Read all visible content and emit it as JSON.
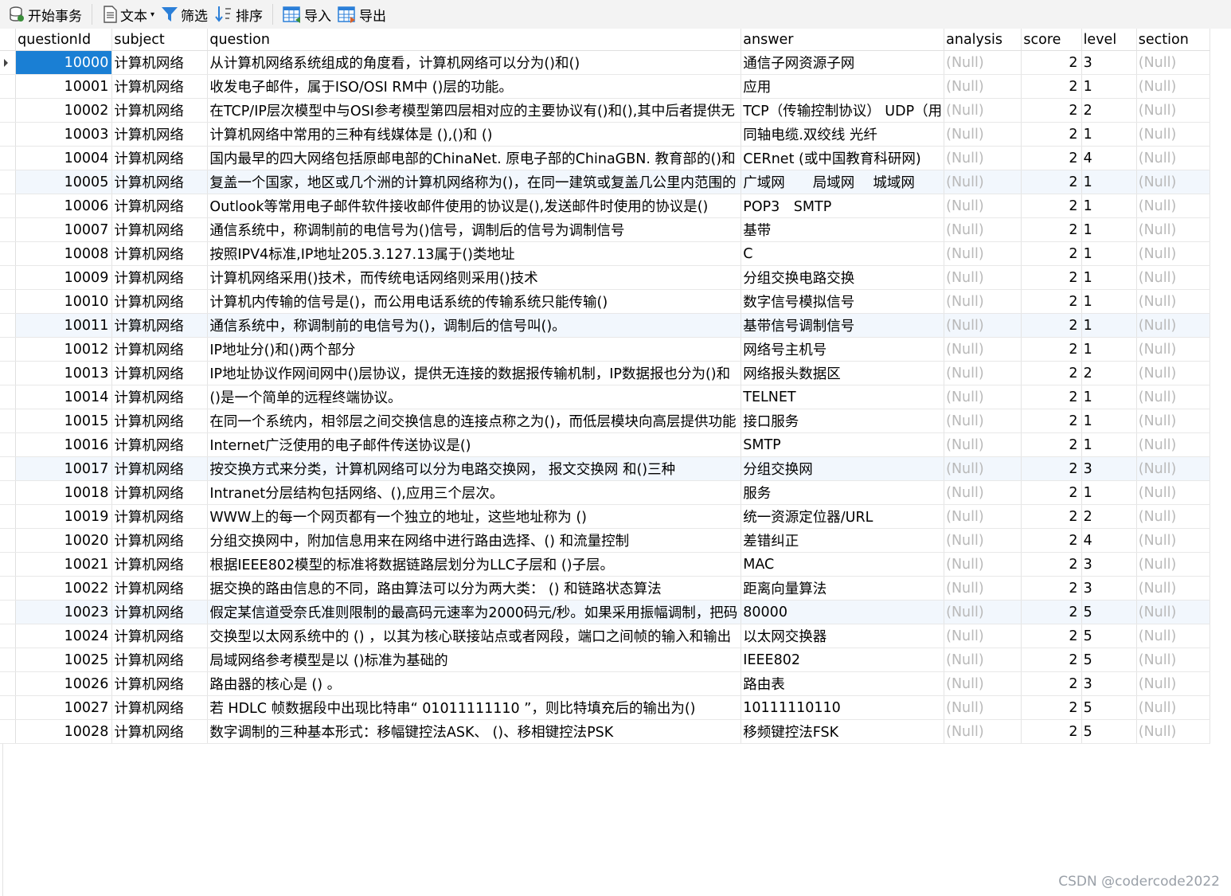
{
  "toolbar": {
    "begin_transaction": "开始事务",
    "text": "文本",
    "filter": "筛选",
    "sort": "排序",
    "import": "导入",
    "export": "导出"
  },
  "columns": [
    "questionId",
    "subject",
    "question",
    "answer",
    "analysis",
    "score",
    "level",
    "section"
  ],
  "rows": [
    [
      "10000",
      "计算机网络",
      "从计算机网络系统组成的角度看，计算机网络可以分为()和()",
      "通信子网资源子网",
      "(Null)",
      "2",
      "3",
      "(Null)"
    ],
    [
      "10001",
      "计算机网络",
      "收发电子邮件，属于ISO/OSI RM中 ()层的功能。",
      "应用",
      "(Null)",
      "2",
      "1",
      "(Null)"
    ],
    [
      "10002",
      "计算机网络",
      "在TCP/IP层次模型中与OSI参考模型第四层相对应的主要协议有()和(),其中后者提供无",
      "TCP（传输控制协议） UDP（用",
      "(Null)",
      "2",
      "2",
      "(Null)"
    ],
    [
      "10003",
      "计算机网络",
      "计算机网络中常用的三种有线媒体是 (),()和 ()",
      "同轴电缆.双绞线 光纤",
      "(Null)",
      "2",
      "1",
      "(Null)"
    ],
    [
      "10004",
      "计算机网络",
      "国内最早的四大网络包括原邮电部的ChinaNet. 原电子部的ChinaGBN. 教育部的()和",
      "CERnet (或中国教育科研网)",
      "(Null)",
      "2",
      "4",
      "(Null)"
    ],
    [
      "10005",
      "计算机网络",
      "复盖一个国家，地区或几个洲的计算机网络称为()，在同一建筑或复盖几公里内范围的",
      "广域网　　局域网　 城域网",
      "(Null)",
      "2",
      "1",
      "(Null)"
    ],
    [
      "10006",
      "计算机网络",
      "Outlook等常用电子邮件软件接收邮件使用的协议是(),发送邮件时使用的协议是()",
      "POP3　SMTP",
      "(Null)",
      "2",
      "1",
      "(Null)"
    ],
    [
      "10007",
      "计算机网络",
      "通信系统中，称调制前的电信号为()信号，调制后的信号为调制信号",
      "基带",
      "(Null)",
      "2",
      "1",
      "(Null)"
    ],
    [
      "10008",
      "计算机网络",
      "按照IPV4标准,IP地址205.3.127.13属于()类地址",
      "C",
      "(Null)",
      "2",
      "1",
      "(Null)"
    ],
    [
      "10009",
      "计算机网络",
      "计算机网络采用()技术，而传统电话网络则采用()技术",
      "分组交换电路交换",
      "(Null)",
      "2",
      "1",
      "(Null)"
    ],
    [
      "10010",
      "计算机网络",
      "计算机内传输的信号是()，而公用电话系统的传输系统只能传输()",
      "数字信号模拟信号",
      "(Null)",
      "2",
      "1",
      "(Null)"
    ],
    [
      "10011",
      "计算机网络",
      "通信系统中，称调制前的电信号为()，调制后的信号叫()。",
      "基带信号调制信号",
      "(Null)",
      "2",
      "1",
      "(Null)"
    ],
    [
      "10012",
      "计算机网络",
      "IP地址分()和()两个部分",
      "网络号主机号",
      "(Null)",
      "2",
      "1",
      "(Null)"
    ],
    [
      "10013",
      "计算机网络",
      " IP地址协议作网间网中()层协议，提供无连接的数据报传输机制，IP数据报也分为()和",
      "网络报头数据区",
      "(Null)",
      "2",
      "2",
      "(Null)"
    ],
    [
      "10014",
      "计算机网络",
      "()是一个简单的远程终端协议。",
      "TELNET",
      "(Null)",
      "2",
      "1",
      "(Null)"
    ],
    [
      "10015",
      "计算机网络",
      "在同一个系统内，相邻层之间交换信息的连接点称之为()，而低层模块向高层提供功能",
      "接口服务",
      "(Null)",
      "2",
      "1",
      "(Null)"
    ],
    [
      "10016",
      "计算机网络",
      "Internet广泛使用的电子邮件传送协议是()",
      "SMTP",
      "(Null)",
      "2",
      "1",
      "(Null)"
    ],
    [
      "10017",
      "计算机网络",
      "按交换方式来分类，计算机网络可以分为电路交换网，  报文交换网  和()三种",
      "分组交换网",
      "(Null)",
      "2",
      "3",
      "(Null)"
    ],
    [
      "10018",
      "计算机网络",
      "Intranet分层结构包括网络、(),应用三个层次。",
      "服务",
      "(Null)",
      "2",
      "1",
      "(Null)"
    ],
    [
      "10019",
      "计算机网络",
      "WWW上的每一个网页都有一个独立的地址，这些地址称为  ()",
      "统一资源定位器/URL",
      "(Null)",
      "2",
      "2",
      "(Null)"
    ],
    [
      "10020",
      "计算机网络",
      "分组交换网中，附加信息用来在网络中进行路由选择、() 和流量控制",
      "差错纠正",
      "(Null)",
      "2",
      "4",
      "(Null)"
    ],
    [
      "10021",
      "计算机网络",
      "根据IEEE802模型的标准将数据链路层划分为LLC子层和 ()子层。",
      " MAC",
      "(Null)",
      "2",
      "3",
      "(Null)"
    ],
    [
      "10022",
      "计算机网络",
      "据交换的路由信息的不同，路由算法可以分为两大类：  ()  和链路状态算法",
      "距离向量算法",
      "(Null)",
      "2",
      "3",
      "(Null)"
    ],
    [
      "10023",
      "计算机网络",
      "假定某信道受奈氏准则限制的最高码元速率为2000码元/秒。如果采用振幅调制，把码",
      "80000",
      "(Null)",
      "2",
      "5",
      "(Null)"
    ],
    [
      "10024",
      "计算机网络",
      "交换型以太网系统中的 () ，以其为核心联接站点或者网段，端口之间帧的输入和输出",
      "以太网交换器",
      "(Null)",
      "2",
      "5",
      "(Null)"
    ],
    [
      "10025",
      "计算机网络",
      "局域网络参考模型是以 ()标准为基础的",
      "IEEE802",
      "(Null)",
      "2",
      "5",
      "(Null)"
    ],
    [
      "10026",
      "计算机网络",
      "路由器的核心是 () 。",
      " 路由表",
      "(Null)",
      "2",
      "3",
      "(Null)"
    ],
    [
      "10027",
      "计算机网络",
      "若 HDLC 帧数据段中出现比特串“ 01011111110 ”，则比特填充后的输出为()",
      "10111110110",
      "(Null)",
      "2",
      "5",
      "(Null)"
    ],
    [
      "10028",
      "计算机网络",
      "数字调制的三种基本形式：移幅键控法ASK、 ()、移相键控法PSK",
      "移频键控法FSK",
      "(Null)",
      "2",
      "5",
      "(Null)"
    ]
  ],
  "alt_rows": [
    5,
    11,
    17,
    23
  ],
  "selected_row": 0,
  "watermark": "CSDN @codercode2022"
}
